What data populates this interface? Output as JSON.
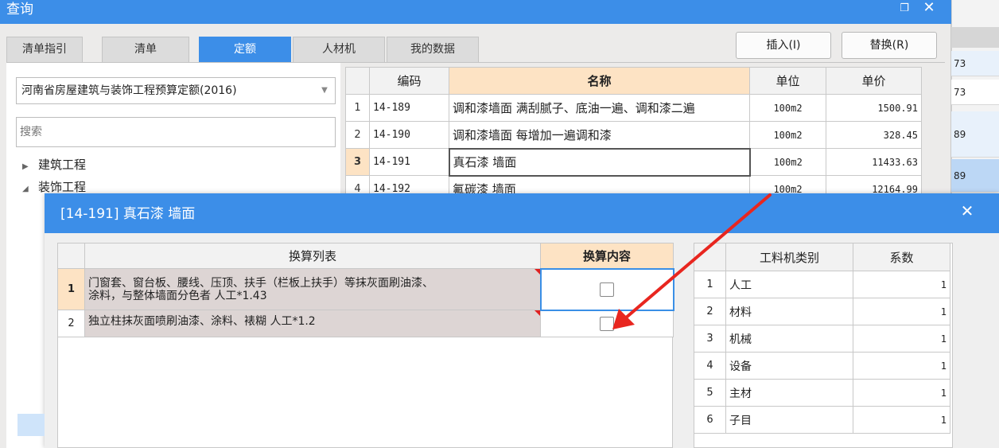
{
  "main_window": {
    "title": "查询",
    "restore_glyph": "❐",
    "close_glyph": "✕",
    "tabs": [
      {
        "label": "清单指引",
        "active": false
      },
      {
        "label": "清单",
        "active": false
      },
      {
        "label": "定额",
        "active": true
      },
      {
        "label": "人材机",
        "active": false
      },
      {
        "label": "我的数据",
        "active": false
      }
    ],
    "insert_button": "插入(I)",
    "replace_button": "替换(R)",
    "quota_select": "河南省房屋建筑与装饰工程预算定额(2016)",
    "search_placeholder": "搜索",
    "tree": [
      {
        "label": "建筑工程",
        "arrow": "▶"
      },
      {
        "label": "装饰工程",
        "arrow": "◢"
      }
    ],
    "quota_table": {
      "headers": [
        "",
        "编码",
        "名称",
        "单位",
        "单价"
      ],
      "rows": [
        {
          "index": "1",
          "code": "14-189",
          "name": "调和漆墙面 满刮腻子、底油一遍、调和漆二遍",
          "unit": "100m2",
          "price": "1500.91"
        },
        {
          "index": "2",
          "code": "14-190",
          "name": "调和漆墙面 每增加一遍调和漆",
          "unit": "100m2",
          "price": "328.45"
        },
        {
          "index": "3",
          "code": "14-191",
          "name": "真石漆 墙面",
          "unit": "100m2",
          "price": "11433.63",
          "selected": true
        },
        {
          "index": "4",
          "code": "14-192",
          "name": "氟碳漆 墙面",
          "unit": "100m2",
          "price": "12164.99"
        }
      ]
    }
  },
  "background_column": [
    "73",
    "73",
    "89",
    "89"
  ],
  "dialog": {
    "title": "[14-191] 真石漆 墙面",
    "close_glyph": "✕",
    "conversion_table": {
      "headers": [
        "",
        "换算列表",
        "换算内容"
      ],
      "rows": [
        {
          "index": "1",
          "text_line1": "门窗套、窗台板、腰线、压顶、扶手（栏板上扶手）等抹灰面刷油漆、",
          "text_line2": "涂料，与整体墙面分色者 人工*1.43",
          "checked": false
        },
        {
          "index": "2",
          "text_line1": "独立柱抹灰面喷刷油漆、涂料、裱糊 人工*1.2",
          "text_line2": "",
          "checked": false
        }
      ]
    },
    "category_table": {
      "headers": [
        "",
        "工料机类别",
        "系数"
      ],
      "rows": [
        {
          "index": "1",
          "category": "人工",
          "coef": "1"
        },
        {
          "index": "2",
          "category": "材料",
          "coef": "1"
        },
        {
          "index": "3",
          "category": "机械",
          "coef": "1"
        },
        {
          "index": "4",
          "category": "设备",
          "coef": "1"
        },
        {
          "index": "5",
          "category": "主材",
          "coef": "1"
        },
        {
          "index": "6",
          "category": "子目",
          "coef": "1"
        }
      ]
    }
  },
  "colors": {
    "accent_blue": "#3c8ee8",
    "highlight_orange": "#fde3c4",
    "annotation_red": "#e8261f"
  }
}
